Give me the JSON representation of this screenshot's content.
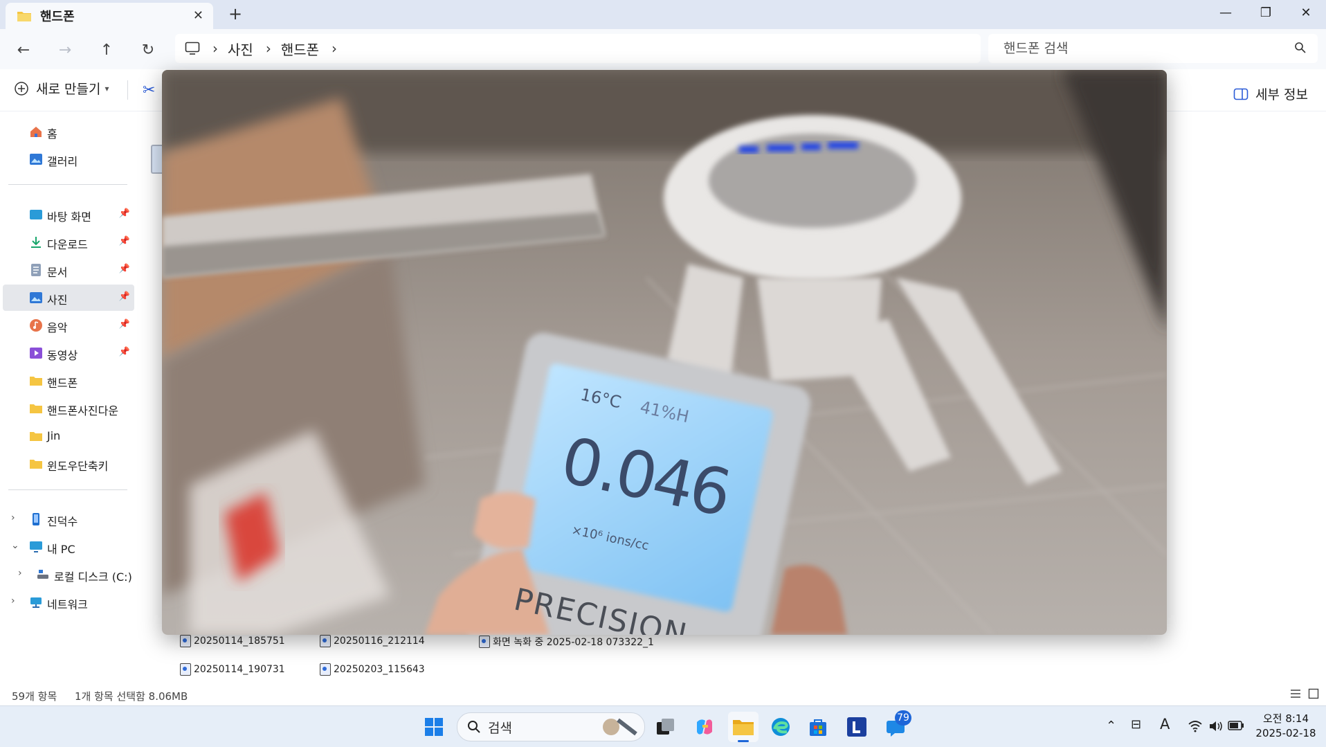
{
  "window": {
    "tab_title": "핸드폰",
    "tab_close": "✕",
    "new_tab": "+",
    "minimize": "—",
    "restore": "❐",
    "close": "✕"
  },
  "nav": {
    "breadcrumb": [
      "사진",
      "핸드폰"
    ],
    "search_placeholder": "핸드폰 검색"
  },
  "commandbar": {
    "new_label": "새로 만들기",
    "details_label": "세부 정보"
  },
  "sidebar": {
    "items": [
      {
        "label": "홈",
        "icon": "home-icon"
      },
      {
        "label": "갤러리",
        "icon": "gallery-icon"
      },
      {
        "label": "바탕 화면",
        "icon": "desktop-icon"
      },
      {
        "label": "다운로드",
        "icon": "download-icon"
      },
      {
        "label": "문서",
        "icon": "document-icon"
      },
      {
        "label": "사진",
        "icon": "pictures-icon"
      },
      {
        "label": "음악",
        "icon": "music-icon"
      },
      {
        "label": "동영상",
        "icon": "video-icon"
      },
      {
        "label": "핸드폰",
        "icon": "folder-icon"
      },
      {
        "label": "핸드폰사진다운",
        "icon": "folder-icon"
      },
      {
        "label": "Jin",
        "icon": "folder-icon"
      },
      {
        "label": "윈도우단축키",
        "icon": "folder-icon"
      },
      {
        "label": "진덕수",
        "icon": "phone-icon"
      },
      {
        "label": "내 PC",
        "icon": "pc-icon"
      },
      {
        "label": "로컬 디스크 (C:)",
        "icon": "disk-icon"
      },
      {
        "label": "네트워크",
        "icon": "network-icon"
      }
    ]
  },
  "files": [
    {
      "name": "20250114_185751"
    },
    {
      "name": "20250116_212114"
    },
    {
      "name": "화면 녹화 중 2025-02-18 073322_1"
    },
    {
      "name": "20250114_190731"
    },
    {
      "name": "20250203_115643"
    }
  ],
  "status": {
    "count": "59개 항목",
    "selection": "1개 항목 선택함 8.06MB"
  },
  "taskbar": {
    "search_label": "검색",
    "badge_count": "79",
    "clock_time": "오전 8:14",
    "clock_date": "2025-02-18"
  },
  "preview": {
    "display_temp": "16°C",
    "display_humidity": "41%H",
    "display_value": "0.046",
    "display_unit": "×10⁶ ions/cc",
    "brand": "PRECISION"
  },
  "colors": {
    "accent": "#1e66d8",
    "folder": "#f5c542"
  }
}
